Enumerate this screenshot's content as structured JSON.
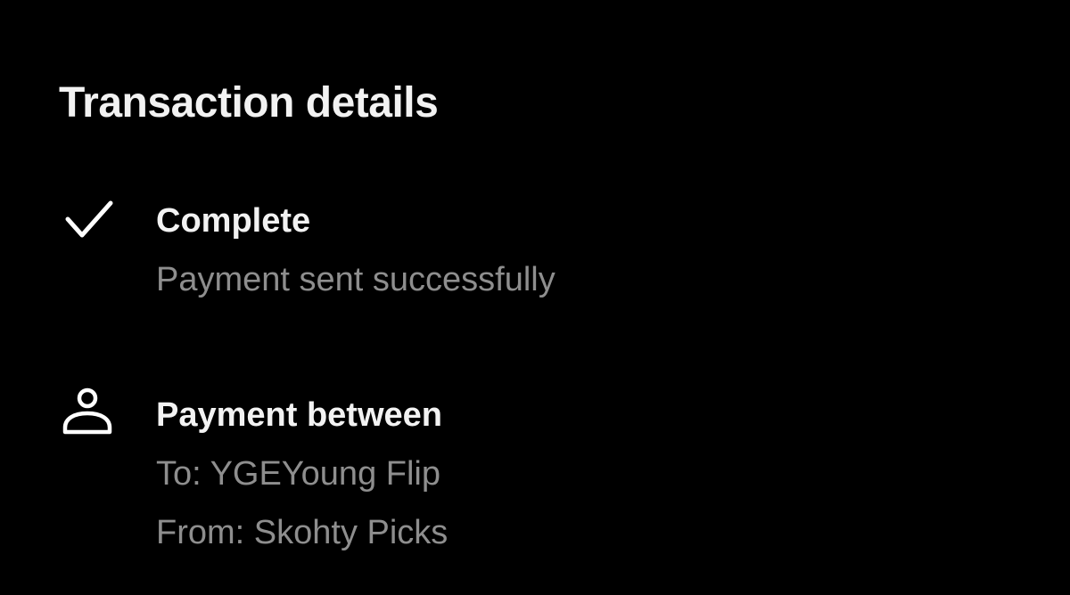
{
  "header": {
    "title": "Transaction details"
  },
  "status": {
    "icon": "checkmark-icon",
    "title": "Complete",
    "subtitle": "Payment sent successfully"
  },
  "parties": {
    "icon": "person-icon",
    "title": "Payment between",
    "to": "To: YGEYoung Flip",
    "from": "From: Skohty Picks"
  },
  "colors": {
    "background": "#000000",
    "primary_text": "#f2f2f2",
    "secondary_text": "#8e8e8e"
  }
}
